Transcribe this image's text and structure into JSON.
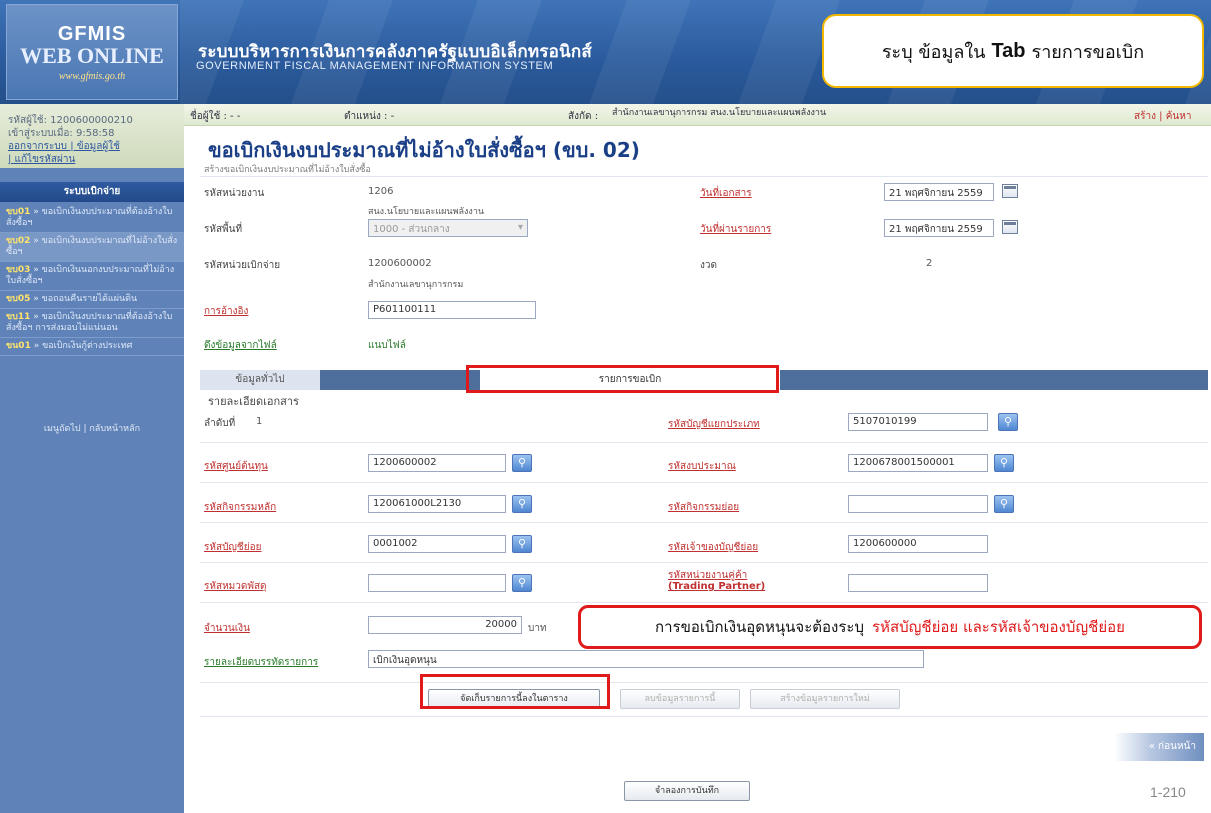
{
  "header": {
    "logo_line1": "GFMIS",
    "logo_line2": "WEB ONLINE",
    "logo_line3": "www.gfmis.go.th",
    "system_thai": "ระบบบริหารการเงินการคลังภาครัฐแบบอิเล็กทรอนิกส์",
    "system_eng": "GOVERNMENT FISCAL MANAGEMENT INFORMATION SYSTEM"
  },
  "callout_top": {
    "prefix": "ระบุ ข้อมูลใน",
    "bold": "Tab",
    "suffix": "รายการขอเบิก"
  },
  "info_bar": {
    "user_label": "ชื่อผู้ใช้ : - -",
    "position_label": "ตำแหน่ง : -",
    "affiliation_label": "สังกัด :",
    "affiliation_value": "สำนักงานเลขานุการกรม สนง.นโยบายและแผนพลังงาน",
    "links": "สร้าง | ค้นหา"
  },
  "user_panel": {
    "user_code": "รหัสผู้ใช้: 1200600000210",
    "login_time": "เข้าสู่ระบบเมื่อ: 9:58:58",
    "logout_link": "ออกจากระบบ | ข้อมูลผู้ใช้",
    "change_pwd_link": "| แก้ไขรหัสผ่าน"
  },
  "sidebar": {
    "title": "ระบบเบิกจ่าย",
    "items": [
      {
        "code": "ขบ01",
        "label": " » ขอเบิกเงินงบประมาณที่ต้องอ้างใบสั่งซื้อฯ"
      },
      {
        "code": "ขบ02",
        "label": " » ขอเบิกเงินงบประมาณที่ไม่อ้างใบสั่งซื้อฯ"
      },
      {
        "code": "ขบ03",
        "label": " » ขอเบิกเงินนอกงบประมาณที่ไม่อ้างใบสั่งซื้อฯ"
      },
      {
        "code": "ขบ05",
        "label": " » ขอถอนคืนรายได้แผ่นดิน"
      },
      {
        "code": "ขบ11",
        "label": " » ขอเบิกเงินงบประมาณที่ต้องอ้างใบสั่งซื้อฯ การส่งมอบไม่แน่นอน"
      },
      {
        "code": "ขน01",
        "label": " » ขอเบิกเงินกู้ต่างประเทศ"
      }
    ],
    "footer": "เมนูถัดไป | กลับหน้าหลัก"
  },
  "page": {
    "title": "ขอเบิกเงินงบประมาณที่ไม่อ้างใบสั่งซื้อฯ (ขบ. 02)",
    "subtitle": "สร้างขอเบิกเงินงบประมาณที่ไม่อ้างใบสั่งซื้อ"
  },
  "form_top": {
    "agency_code_label": "รหัสหน่วยงาน",
    "agency_code_value": "1206",
    "agency_name": "สนง.นโยบายและแผนพลังงาน",
    "area_code_label": "รหัสพื้นที่",
    "area_code_value": "1000 - ส่วนกลาง",
    "disb_unit_label": "รหัสหน่วยเบิกจ่าย",
    "disb_unit_value": "1200600002",
    "disb_unit_name": "สำนักงานเลขานุการกรม",
    "reference_label": "การอ้างอิง",
    "reference_value": "P601100111",
    "file_label": "ดึงข้อมูลจากไฟล์",
    "file_value": "แนบไฟล์",
    "doc_date_label": "วันที่เอกสาร",
    "doc_date_value": "21 พฤศจิกายน 2559",
    "post_date_label": "วันที่ผ่านรายการ",
    "post_date_value": "21 พฤศจิกายน 2559",
    "period_label": "งวด",
    "period_value": "2"
  },
  "tabs": {
    "general": "ข้อมูลทั่วไป",
    "items": "รายการขอเบิก"
  },
  "detail": {
    "header": "รายละเอียดเอกสาร",
    "seq_label": "ลำดับที่",
    "seq_value": "1",
    "gl_label": "รหัสบัญชีแยกประเภท",
    "gl_value": "5107010199",
    "cost_center_label": "รหัสศูนย์ต้นทุน",
    "cost_center_value": "1200600002",
    "budget_label": "รหัสงบประมาณ",
    "budget_value": "1200678001500001",
    "main_activity_label": "รหัสกิจกรรมหลัก",
    "main_activity_value": "120061000L2130",
    "sub_activity_label": "รหัสกิจกรรมย่อย",
    "sub_activity_value": "",
    "sub_account_label": "รหัสบัญชีย่อย",
    "sub_account_value": "0001002",
    "owner_label": "รหัสเจ้าของบัญชีย่อย",
    "owner_value": "1200600000",
    "material_label": "รหัสหมวดพัสดุ",
    "material_value": "",
    "partner_label": "รหัสหน่วยงานคู่ค้า",
    "partner_label2": "(Trading Partner)",
    "partner_value": "",
    "amount_label": "จำนวนเงิน",
    "amount_value": "20000",
    "amount_unit": "บาท",
    "desc_label": "รายละเอียดบรรทัดรายการ",
    "desc_value": "เบิกเงินอุดหนุน"
  },
  "callout_mid": {
    "text": "การขอเบิกเงินอุดหนุนจะต้องระบุ",
    "red": "รหัสบัญชีย่อย และรหัสเจ้าของบัญชีย่อย"
  },
  "buttons": {
    "save_to_table": "จัดเก็บรายการนี้ลงในตาราง",
    "delete_item": "ลบข้อมูลรายการนี้",
    "new_item": "สร้างข้อมูลรายการใหม่",
    "back": "« ก่อนหน้า",
    "simulate_save": "จำลองการบันทึก"
  },
  "footer": {
    "page_number": "1-210"
  }
}
